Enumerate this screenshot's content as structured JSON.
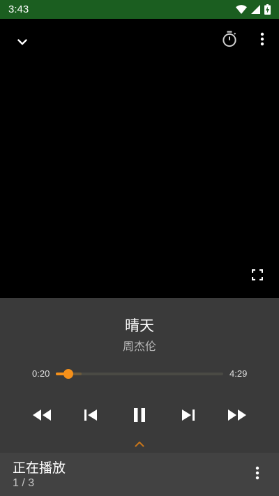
{
  "status_bar": {
    "time": "3:43",
    "background": "#1b5e20"
  },
  "video": {
    "collapse_icon": "chevron-down-icon",
    "timer_icon": "timer-icon",
    "more_icon": "more-vert-icon",
    "fullscreen_icon": "fullscreen-icon"
  },
  "now_playing": {
    "title": "晴天",
    "artist": "周杰伦"
  },
  "progress": {
    "current_time": "0:20",
    "total_time": "4:29",
    "played_fraction": 0.074,
    "buffered_fraction": 0.155,
    "accent_color": "#f5901a"
  },
  "controls": {
    "rewind_icon": "fast-rewind-icon",
    "previous_icon": "skip-previous-icon",
    "pause_icon": "pause-icon",
    "next_icon": "skip-next-icon",
    "fast_forward_icon": "fast-forward-icon",
    "expand_icon": "chevron-up-icon"
  },
  "queue": {
    "title": "正在播放",
    "position": "1 / 3"
  }
}
